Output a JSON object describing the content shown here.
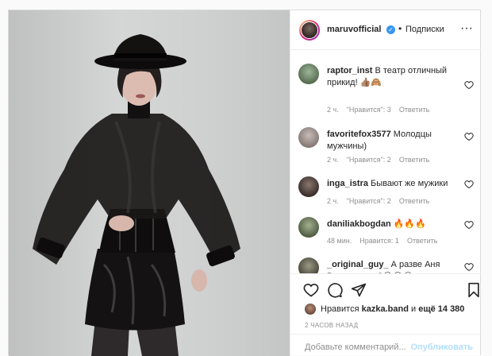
{
  "header": {
    "username": "maruvofficial",
    "verified_icon": "check-icon",
    "separator": "•",
    "follow_label": "Подписки",
    "more_icon": "more-horizontal-icon"
  },
  "comments": [
    {
      "username": "raptor_inst",
      "text": "В театр отличный прикид! 👍🏽🙈",
      "time": "2 ч.",
      "likes": "\"Нравится\": 3",
      "reply": "Ответить",
      "avatar_color": "#6f8a6a"
    },
    {
      "username": "favoritefox3577",
      "text": "Молодцы мужчины)",
      "time": "2 ч.",
      "likes": "\"Нравится\": 2",
      "reply": "Ответить",
      "avatar_color": "#9a8f8c"
    },
    {
      "username": "inga_istra",
      "text": "Бывают же мужики",
      "time": "2 ч.",
      "likes": "\"Нравится\": 2",
      "reply": "Ответить",
      "avatar_color": "#4a3f3a"
    },
    {
      "username": "daniliakbogdan",
      "text": "🔥🔥🔥",
      "time": "48 мин.",
      "likes": "Нравится: 1",
      "reply": "Ответить",
      "avatar_color": "#5d6b4e"
    },
    {
      "username": "_original_guy_",
      "text": "А разве Аня Вы в одежке?😂😂😂",
      "time": "",
      "likes": "",
      "reply": "",
      "avatar_color": "#5a5a50"
    }
  ],
  "actions": {
    "like_icon": "heart-icon",
    "comment_icon": "comment-icon",
    "share_icon": "share-icon",
    "save_icon": "bookmark-icon"
  },
  "likes": {
    "prefix": "Нравится",
    "user": "kazka.band",
    "middle": "и",
    "count_text": "ещё 14 380"
  },
  "time_ago": "2 ЧАСОВ НАЗАД",
  "add_comment": {
    "placeholder": "Добавьте комментарий...",
    "publish_label": "Опубликовать"
  },
  "colors": {
    "verified": "#3897f0",
    "publish_disabled": "#b2dffc",
    "meta_text": "#8e8e8e"
  }
}
